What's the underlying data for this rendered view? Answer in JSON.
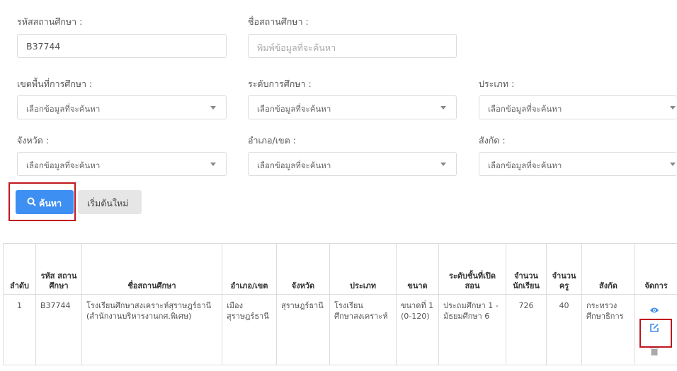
{
  "form": {
    "school_code_label": "รหัสสถานศึกษา :",
    "school_code_value": "B37744",
    "school_name_label": "ชื่อสถานศึกษา :",
    "school_name_placeholder": "พิมพ์ข้อมูลที่จะค้นหา",
    "area_label": "เขตพื้นที่การศึกษา :",
    "level_label": "ระดับการศึกษา :",
    "type_label": "ประเภท :",
    "province_label": "จังหวัด :",
    "district_label": "อำเภอ/เขต :",
    "affiliation_label": "สังกัด :",
    "select_placeholder": "เลือกข้อมูลที่จะค้นหา"
  },
  "buttons": {
    "search_label": "ค้นหา",
    "reset_label": "เริ่มต้นใหม่"
  },
  "table": {
    "headers": [
      "ลำดับ",
      "รหัส สถาน ศึกษา",
      "ชื่อสถานศึกษา",
      "อำเภอ/เขต",
      "จังหวัด",
      "ประเภท",
      "ขนาด",
      "ระดับชั้นที่เปิด สอน",
      "จำนวน นักเรียน",
      "จำนวน ครู",
      "สังกัด",
      "จัดการ"
    ],
    "rows": [
      {
        "no": "1",
        "code": "B37744",
        "name": "โรงเรียนศึกษาสงเคราะห์สุราษฎร์ธานี (สำนักงานบริหารงานกศ.พิเศษ)",
        "district": "เมือง สุราษฎร์ธานี",
        "province": "สุราษฎร์ธานี",
        "type": "โรงเรียน ศึกษาสงเคราะห์",
        "size": "ขนาดที่ 1 (0-120)",
        "levels": "ประถมศึกษา 1 - มัธยมศึกษา 6",
        "students": "726",
        "teachers": "40",
        "affiliation": "กระทรวง ศึกษาธิการ"
      }
    ]
  },
  "icons": {
    "search": "search-icon",
    "view": "eye-icon",
    "edit": "edit-icon",
    "delete": "trash-icon"
  },
  "colors": {
    "primary": "#3d8ff2",
    "highlight": "#c0171d"
  }
}
